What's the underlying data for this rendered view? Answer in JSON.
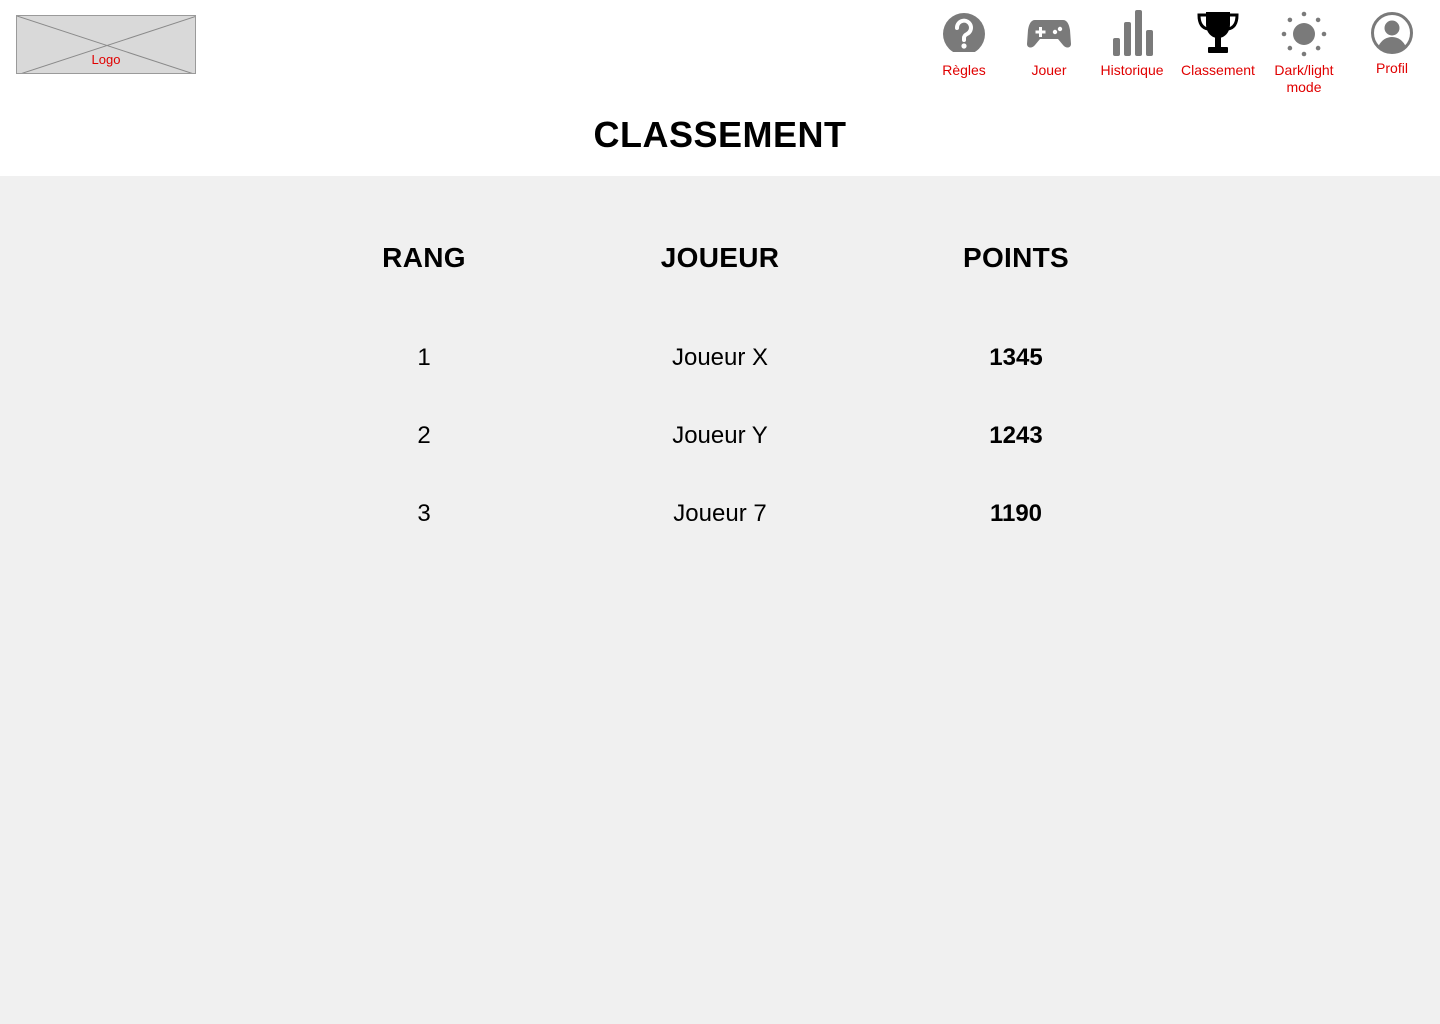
{
  "logo": {
    "label": "Logo"
  },
  "nav": [
    {
      "label": "Règles",
      "icon": "help-circle-icon"
    },
    {
      "label": "Jouer",
      "icon": "gamepad-icon"
    },
    {
      "label": "Historique",
      "icon": "bar-chart-icon"
    },
    {
      "label": "Classement",
      "icon": "trophy-icon"
    },
    {
      "label": "Dark/light mode",
      "icon": "sun-icon"
    },
    {
      "label": "Profil",
      "icon": "user-circle-icon"
    }
  ],
  "page": {
    "title": "CLASSEMENT"
  },
  "table": {
    "headers": [
      "RANG",
      "JOUEUR",
      "POINTS"
    ],
    "rows": [
      {
        "rank": "1",
        "player": "Joueur X",
        "points": "1345"
      },
      {
        "rank": "2",
        "player": "Joueur Y",
        "points": "1243"
      },
      {
        "rank": "3",
        "player": "Joueur 7",
        "points": "1190"
      }
    ]
  },
  "colors": {
    "nav_label": "#e00000",
    "icon_inactive": "#7a7a7a",
    "icon_active": "#000000",
    "main_bg": "#f0f0f0"
  }
}
